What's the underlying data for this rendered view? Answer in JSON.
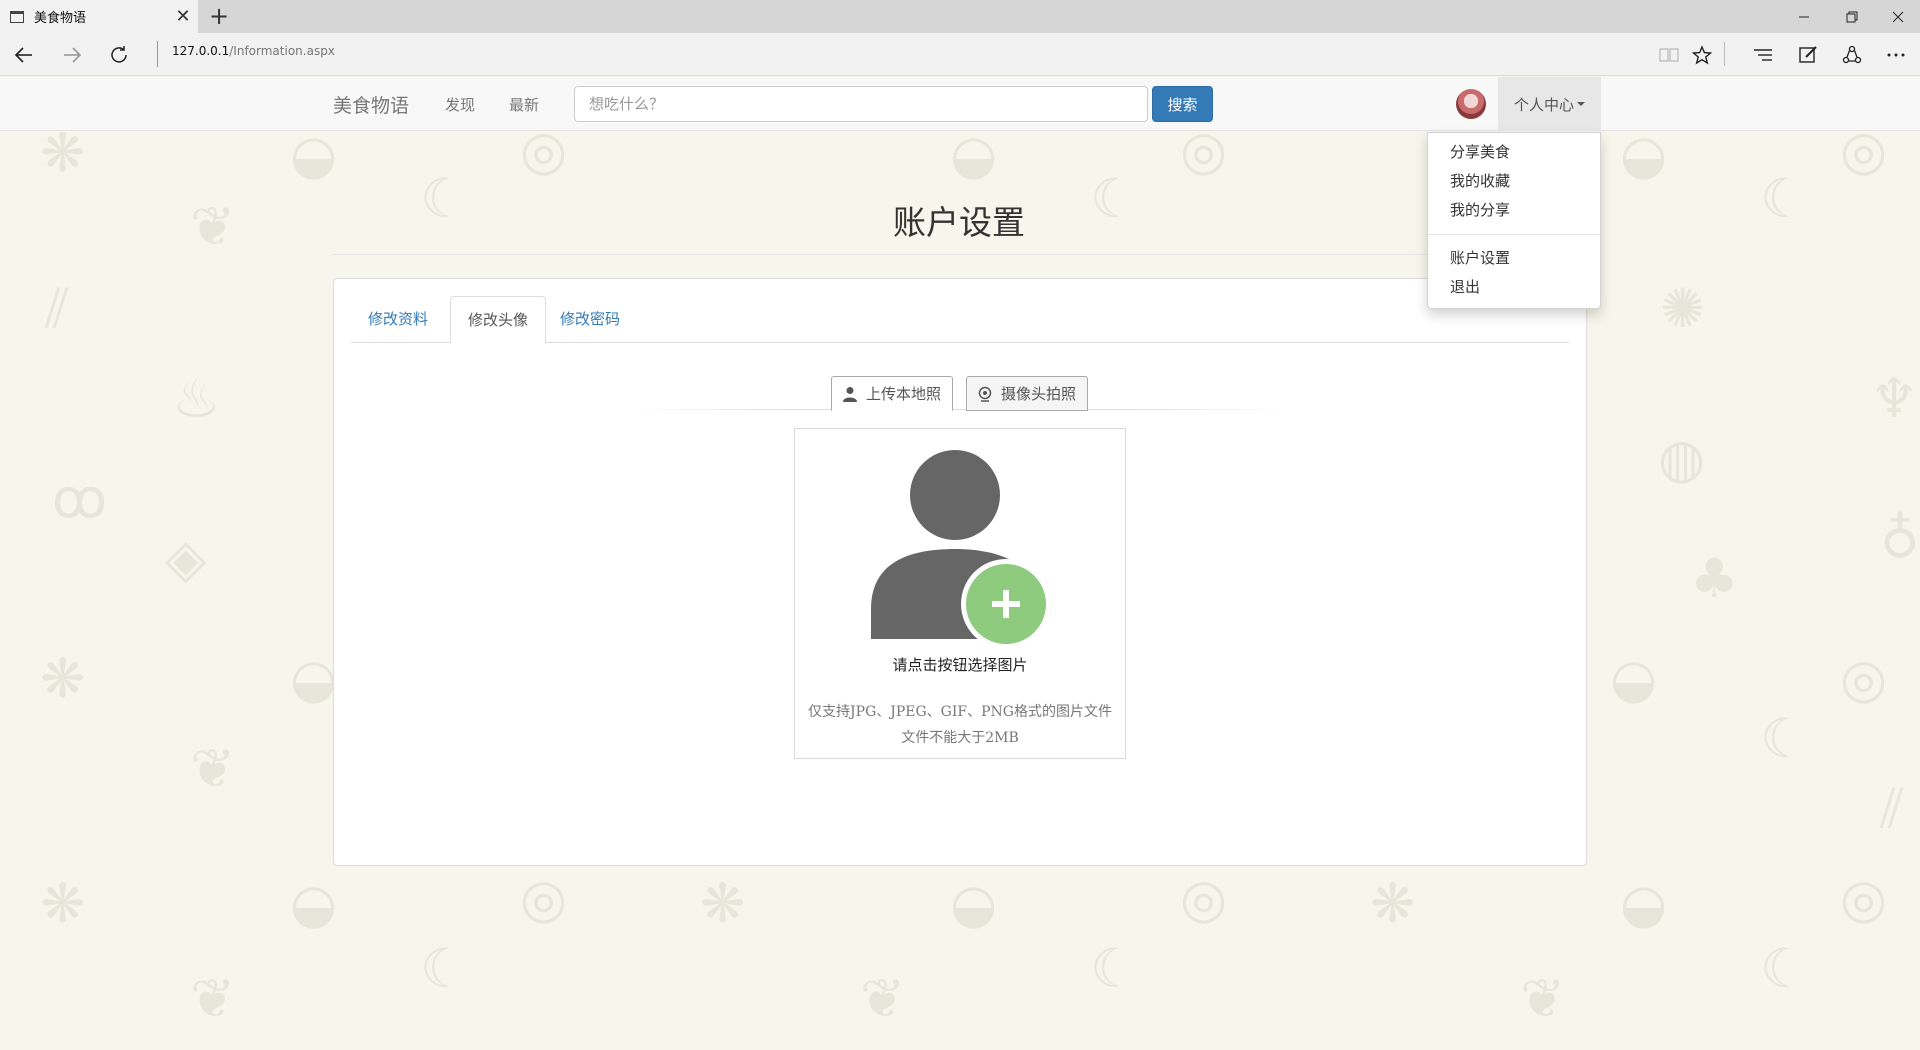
{
  "browser": {
    "tab_title": "美食物语",
    "url_host": "127.0.0.1",
    "url_path": "/Information.aspx"
  },
  "site": {
    "brand": "美食物语",
    "nav": {
      "discover": "发现",
      "latest": "最新"
    },
    "search": {
      "placeholder": "想吃什么？",
      "button": "搜索"
    },
    "user_menu": {
      "label": "个人中心",
      "items": [
        "分享美食",
        "我的收藏",
        "我的分享"
      ],
      "items_2": [
        "账户设置",
        "退出"
      ]
    }
  },
  "page": {
    "title": "账户设置",
    "tabs": [
      "修改资料",
      "修改头像",
      "修改密码"
    ],
    "active_tab": "修改头像",
    "subtabs": [
      "上传本地照",
      "摄像头拍照"
    ],
    "upload": {
      "prompt": "请点击按钮选择图片",
      "note_line1": "仅支持JPG、JPEG、GIF、PNG格式的图片文件",
      "note_line2": "文件不能大于2MB"
    }
  },
  "colors": {
    "primary": "#337ab7",
    "plus_green": "#8fcb7e",
    "avatar_gray": "#666666",
    "background": "#f7f6ec"
  },
  "icons": [
    "page-icon",
    "close-icon",
    "plus-icon",
    "minimize-icon",
    "restore-icon",
    "back-arrow-icon",
    "forward-arrow-icon",
    "refresh-icon",
    "reading-view-icon",
    "favorite-star-icon",
    "hub-icon",
    "web-note-icon",
    "share-icon",
    "more-icon",
    "user-icon",
    "webcam-icon"
  ]
}
